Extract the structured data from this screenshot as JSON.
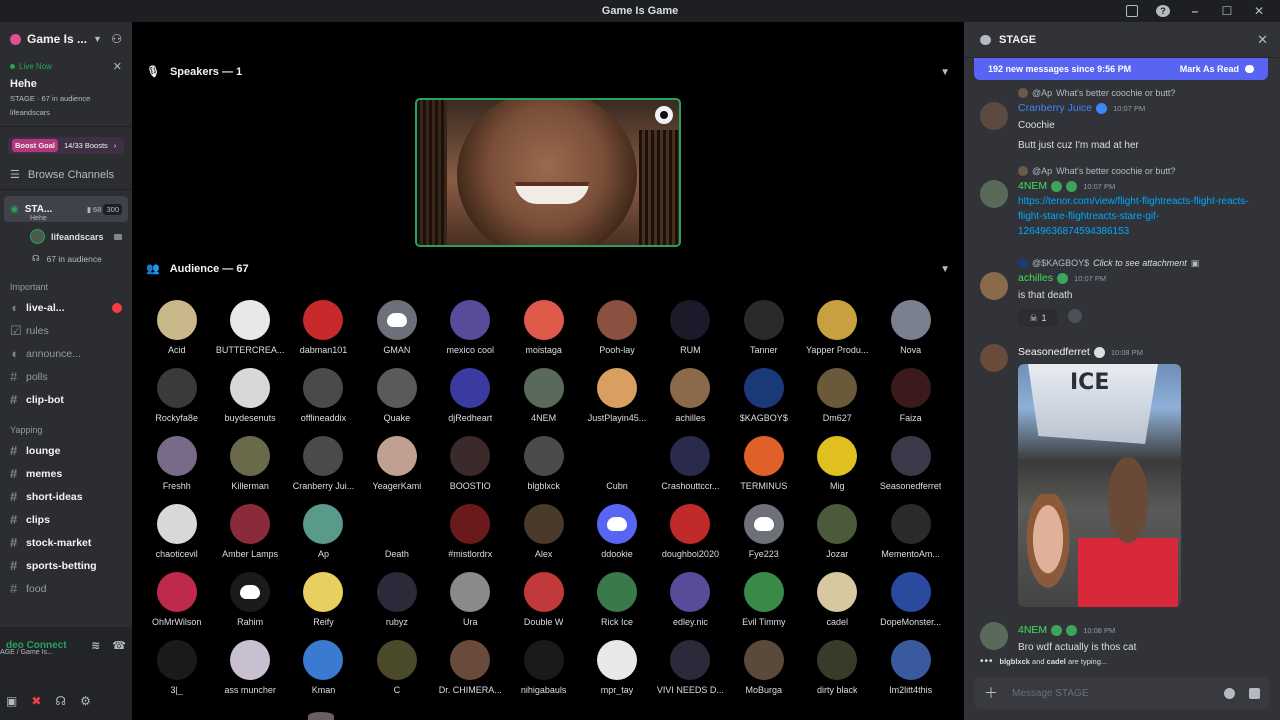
{
  "window": {
    "title": "Game Is Game"
  },
  "sidebar": {
    "server_name": "Game Is ...",
    "live": {
      "label": "Live Now",
      "title": "Hehe",
      "meta": "STAGE · 67 in audience",
      "host": "lifeandscars"
    },
    "boost": {
      "tag": "Boost Goal",
      "progress": "14/33 Boosts"
    },
    "browse_label": "Browse Channels",
    "stage": {
      "name": "STA...",
      "topic": "Hehe",
      "video_count": "68",
      "limit": "300",
      "speaker": "lifeandscars",
      "audience": "67 in audience"
    },
    "categories": [
      {
        "name": "Important",
        "channels": [
          {
            "name": "live-al...",
            "unread": true,
            "badge": true
          },
          {
            "name": "rules",
            "unread": false
          },
          {
            "name": "announce...",
            "unread": false
          },
          {
            "name": "polls",
            "unread": false
          },
          {
            "name": "clip-bot",
            "unread": true
          }
        ]
      },
      {
        "name": "Yapping",
        "channels": [
          {
            "name": "lounge",
            "unread": true
          },
          {
            "name": "memes",
            "unread": true
          },
          {
            "name": "short-ideas",
            "unread": true
          },
          {
            "name": "clips",
            "unread": true
          },
          {
            "name": "stock-market",
            "unread": true
          },
          {
            "name": "sports-betting",
            "unread": true
          },
          {
            "name": "food",
            "unread": false
          }
        ]
      }
    ],
    "voice_status": "deo Connect",
    "voice_sub": "AGE / Game Is..."
  },
  "stage_main": {
    "speakers_label": "Speakers — 1",
    "audience_label": "Audience — 67",
    "audience": [
      {
        "name": "Acid",
        "color": "#c9b98a"
      },
      {
        "name": "BUTTERCREA...",
        "color": "#e8e8e8"
      },
      {
        "name": "dabman101",
        "color": "#c62a2a"
      },
      {
        "name": "GMAN",
        "color": "#6d7078",
        "discord": true
      },
      {
        "name": "mexico cool",
        "color": "#5a4a9a"
      },
      {
        "name": "moistaga",
        "color": "#e05a4a"
      },
      {
        "name": "Pooh-lay",
        "color": "#8a5040"
      },
      {
        "name": "RUM",
        "color": "#1a1a2a"
      },
      {
        "name": "Tanner",
        "color": "#2a2a2a"
      },
      {
        "name": "Yapper Produ...",
        "color": "#c8a040"
      },
      {
        "name": "Nova",
        "color": "#7a8090"
      },
      {
        "name": "Rockyfa8e",
        "color": "#3a3a3a"
      },
      {
        "name": "buydesenuts",
        "color": "#d8d8d8"
      },
      {
        "name": "offlineaddix",
        "color": "#4a4a4a"
      },
      {
        "name": "Quake",
        "color": "#5a5a5a"
      },
      {
        "name": "djRedheart",
        "color": "#3a3aa0"
      },
      {
        "name": "4NEM",
        "color": "#5a6a5a"
      },
      {
        "name": "JustPlayin45...",
        "color": "#d8a060"
      },
      {
        "name": "achilles",
        "color": "#8a6a4a"
      },
      {
        "name": "$KAGBOY$",
        "color": "#1a3a7a"
      },
      {
        "name": "Dm627",
        "color": "#6a5a3a"
      },
      {
        "name": "Faiza",
        "color": "#3a1a1a"
      },
      {
        "name": "Freshh",
        "color": "#7a6a8a"
      },
      {
        "name": "Killerman",
        "color": "#6a6a4a"
      },
      {
        "name": "Cranberry Jui...",
        "color": "#4a4a4a"
      },
      {
        "name": "YeagerKami",
        "color": "#c0a090"
      },
      {
        "name": "BOOSTIO",
        "color": "#3a2a2a"
      },
      {
        "name": "blgblxck",
        "color": "#4a4a4a"
      },
      {
        "name": "Cubn",
        "color": "#000000"
      },
      {
        "name": "Crashouttccr...",
        "color": "#2a2a4a"
      },
      {
        "name": "TERMINUS",
        "color": "#e0602a"
      },
      {
        "name": "Mig",
        "color": "#e0c020"
      },
      {
        "name": "Seasonedferret",
        "color": "#3a3a4a"
      },
      {
        "name": "chaoticevil",
        "color": "#d8d8d8"
      },
      {
        "name": "Amber Lamps",
        "color": "#8a2a3a"
      },
      {
        "name": "Ap",
        "color": "#5a9a8a"
      },
      {
        "name": "Death",
        "color": "#000000"
      },
      {
        "name": "#mistlordrx",
        "color": "#6a1a1a"
      },
      {
        "name": "Alex",
        "color": "#4a3a2a"
      },
      {
        "name": "ddookie",
        "color": "#5865f2",
        "discord": true
      },
      {
        "name": "doughboi2020",
        "color": "#c02a2a"
      },
      {
        "name": "Fye223",
        "color": "#6d7078",
        "discord": true
      },
      {
        "name": "Jozar",
        "color": "#4a5a3a"
      },
      {
        "name": "MementoAm...",
        "color": "#2a2a2a"
      },
      {
        "name": "OhMrWilson",
        "color": "#c02a4a"
      },
      {
        "name": "Rahim",
        "color": "#1a1a1a",
        "discord": true
      },
      {
        "name": "Reify",
        "color": "#e8d060"
      },
      {
        "name": "rubyz",
        "color": "#2a2a3a"
      },
      {
        "name": "Ura",
        "color": "#8a8a8a"
      },
      {
        "name": "Double W",
        "color": "#c03a3a"
      },
      {
        "name": "Rick Ice",
        "color": "#3a7a4a"
      },
      {
        "name": "edley.nic",
        "color": "#5a4a9a"
      },
      {
        "name": "Evil Timmy",
        "color": "#3a8a4a"
      },
      {
        "name": "cadel",
        "color": "#d8c8a0"
      },
      {
        "name": "DopeMonster...",
        "color": "#2a4aa0"
      },
      {
        "name": "3|_",
        "color": "#1a1a1a"
      },
      {
        "name": "ass muncher",
        "color": "#c8c0d0"
      },
      {
        "name": "Kman",
        "color": "#3a7ad0"
      },
      {
        "name": "C",
        "color": "#4a4a2a"
      },
      {
        "name": "Dr. CHIMERA...",
        "color": "#6a4a3a"
      },
      {
        "name": "nihigabauls",
        "color": "#1a1a1a"
      },
      {
        "name": "mpr_tay",
        "color": "#e8e8e8"
      },
      {
        "name": "VIVI NEEDS D...",
        "color": "#2a2a3a"
      },
      {
        "name": "MoBurga",
        "color": "#5a4a3a"
      },
      {
        "name": "dirty black",
        "color": "#3a3a2a"
      },
      {
        "name": "Im2litt4this",
        "color": "#3a5aa0"
      }
    ]
  },
  "chat": {
    "title": "STAGE",
    "new_messages": "192 new messages since 9:56 PM",
    "mark_read": "Mark As Read",
    "messages": [
      {
        "reply_to": "@Ap",
        "reply_text": "What's better coochie or butt?",
        "author": "Cranberry Juice",
        "author_color": "#3d87f5",
        "time": "10:07 PM",
        "lines": [
          "Coochie",
          "Butt just cuz I'm mad at her"
        ]
      },
      {
        "reply_to": "@Ap",
        "reply_text": "What's better coochie or butt?",
        "author": "4NEM",
        "author_color": "#43e05a",
        "time": "10:07 PM",
        "link": "https://tenor.com/view/flight-flightreacts-flight-reacts-flight-stare-flightreacts-stare-gif-12649636874594386153"
      },
      {
        "reply_to": "@$KAGBOY$",
        "reply_text": "Click to see attachment",
        "author": "achilles",
        "author_color": "#43e05a",
        "time": "10:07 PM",
        "lines": [
          "is that death"
        ],
        "reaction_count": "1"
      },
      {
        "author": "Seasonedferret",
        "author_color": "#f2f3f5",
        "time": "10:08 PM"
      },
      {
        "author": "4NEM",
        "author_color": "#43e05a",
        "time": "10:08 PM",
        "lines": [
          "Bro wdf actually is thos cat"
        ]
      }
    ],
    "typing": {
      "user1": "blgblxck",
      "and": "and",
      "user2": "cadel",
      "suffix": "are typing..."
    },
    "composer_placeholder": "Message STAGE"
  }
}
